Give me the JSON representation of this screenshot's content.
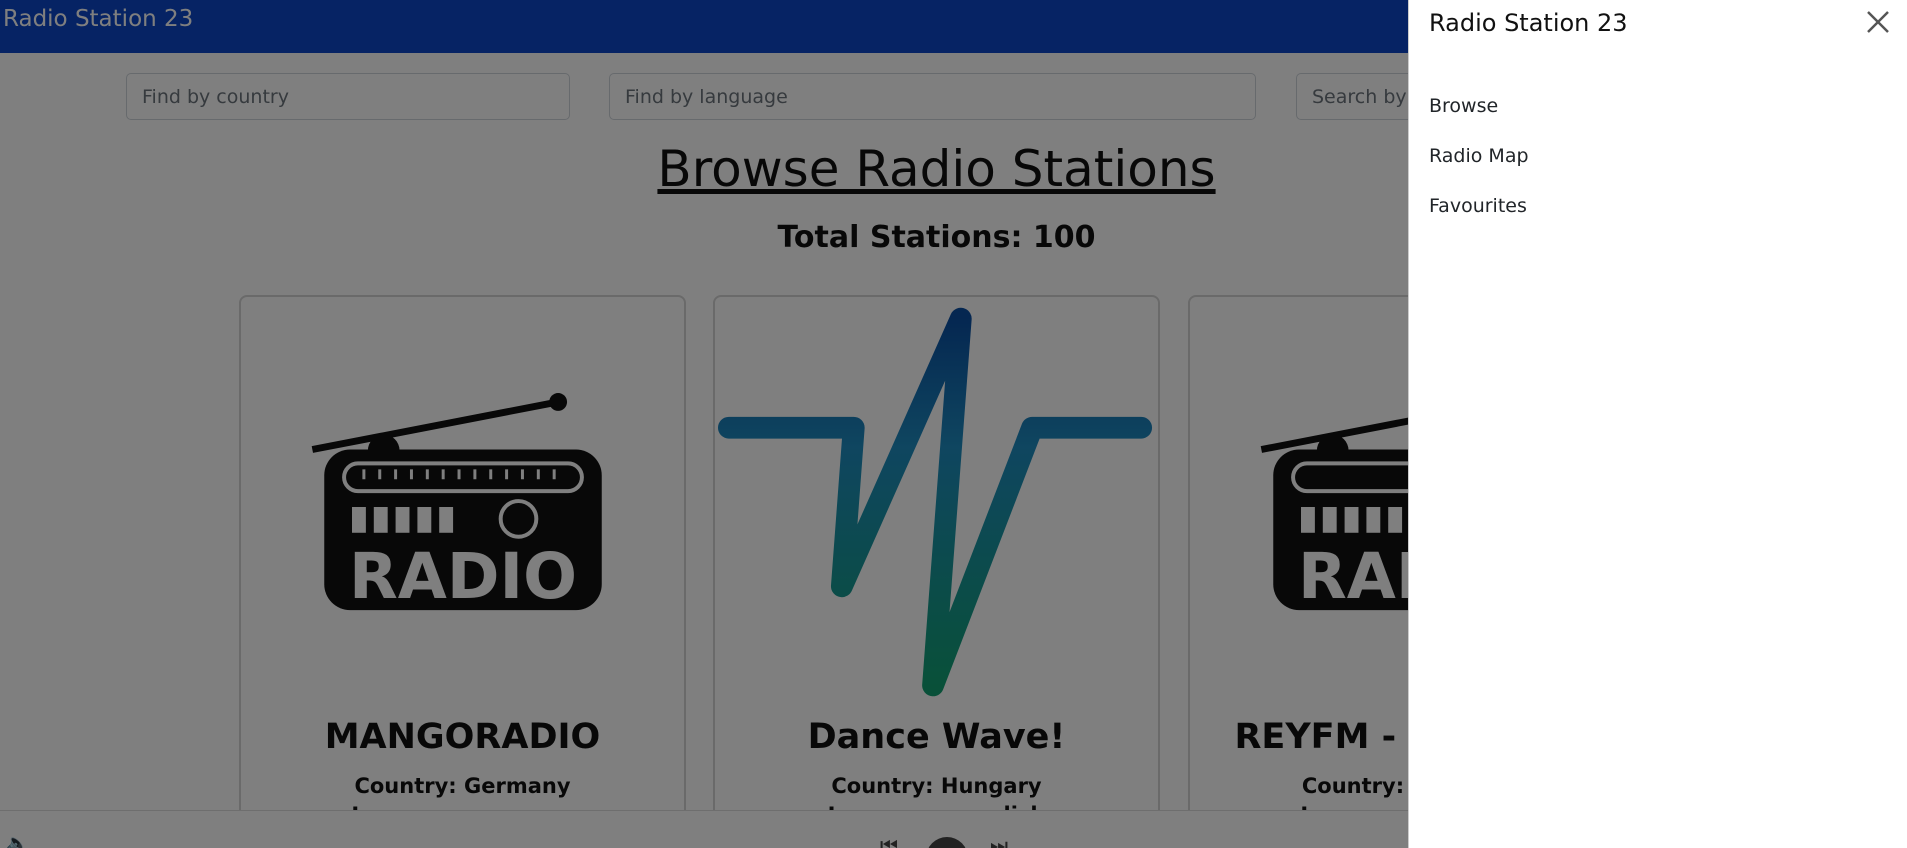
{
  "navbar": {
    "brand": "Radio Station 23"
  },
  "search": {
    "country_placeholder": "Find by country",
    "language_placeholder": "Find by language",
    "name_placeholder": "Search by name"
  },
  "main": {
    "title": "Browse Radio Stations",
    "total": "Total Stations: 100"
  },
  "stations": [
    {
      "name": "MANGORADIO",
      "country": "Country: Germany",
      "language": "Language: german",
      "logo": "radio-logo-icon"
    },
    {
      "name": "Dance Wave!",
      "country": "Country: Hungary",
      "language": "Language: english",
      "logo": "wave-logo-icon"
    },
    {
      "name": "REYFM - #original",
      "country": "Country: Unknown",
      "language": "Language: german",
      "logo": "radio-logo-icon"
    }
  ],
  "offcanvas": {
    "title": "Radio Station 23",
    "links": [
      "Browse",
      "Radio Map",
      "Favourites"
    ]
  },
  "colors": {
    "navbar": "#0d47c9",
    "backdrop": "rgba(0,0,0,0.5)",
    "wave_top": "#0a4fa3",
    "wave_bottom": "#12a173"
  }
}
